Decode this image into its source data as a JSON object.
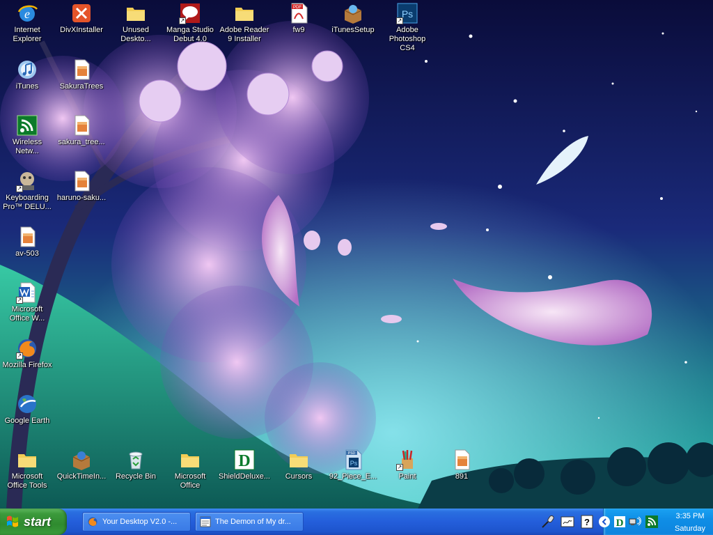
{
  "desktop": {
    "icons": [
      {
        "label": "Internet Explorer"
      },
      {
        "label": "DivXInstaller"
      },
      {
        "label": "Unused Deskto..."
      },
      {
        "label": "Manga Studio Debut 4.0"
      },
      {
        "label": "Adobe Reader 9 Installer"
      },
      {
        "label": "fw9"
      },
      {
        "label": "iTunesSetup"
      },
      {
        "label": "Adobe Photoshop CS4"
      },
      {
        "label": "iTunes"
      },
      {
        "label": "SakuraTrees"
      },
      {
        "label": "Wireless Netw..."
      },
      {
        "label": "sakura_tree..."
      },
      {
        "label": "Keyboarding Pro™ DELU..."
      },
      {
        "label": "haruno-saku..."
      },
      {
        "label": "av-503"
      },
      {
        "label": "Microsoft Office W..."
      },
      {
        "label": "Mozilla Firefox"
      },
      {
        "label": "Google Earth"
      },
      {
        "label": "Microsoft Office Tools"
      },
      {
        "label": "QuickTimeIn..."
      },
      {
        "label": "Recycle Bin"
      },
      {
        "label": "Microsoft Office"
      },
      {
        "label": "ShieldDeluxe..."
      },
      {
        "label": "Cursors"
      },
      {
        "label": "92_Piece_E..."
      },
      {
        "label": "Paint"
      },
      {
        "label": "891"
      }
    ]
  },
  "taskbar": {
    "start_label": "start",
    "tasks": [
      {
        "label": "Your Desktop V2.0 -..."
      },
      {
        "label": "The Demon of My dr..."
      }
    ],
    "clock": {
      "time": "3:35 PM",
      "day": "Saturday"
    }
  },
  "icons": {
    "pdf_badge": "PDF",
    "psd_badge": "PSD",
    "photoshop_badge": "Ps",
    "shield_letter": "D",
    "shortcut_arrow": "↗"
  },
  "colors": {
    "taskbar": "#245edb",
    "start_button": "#3c9a3c",
    "tray": "#0f8ee6"
  }
}
